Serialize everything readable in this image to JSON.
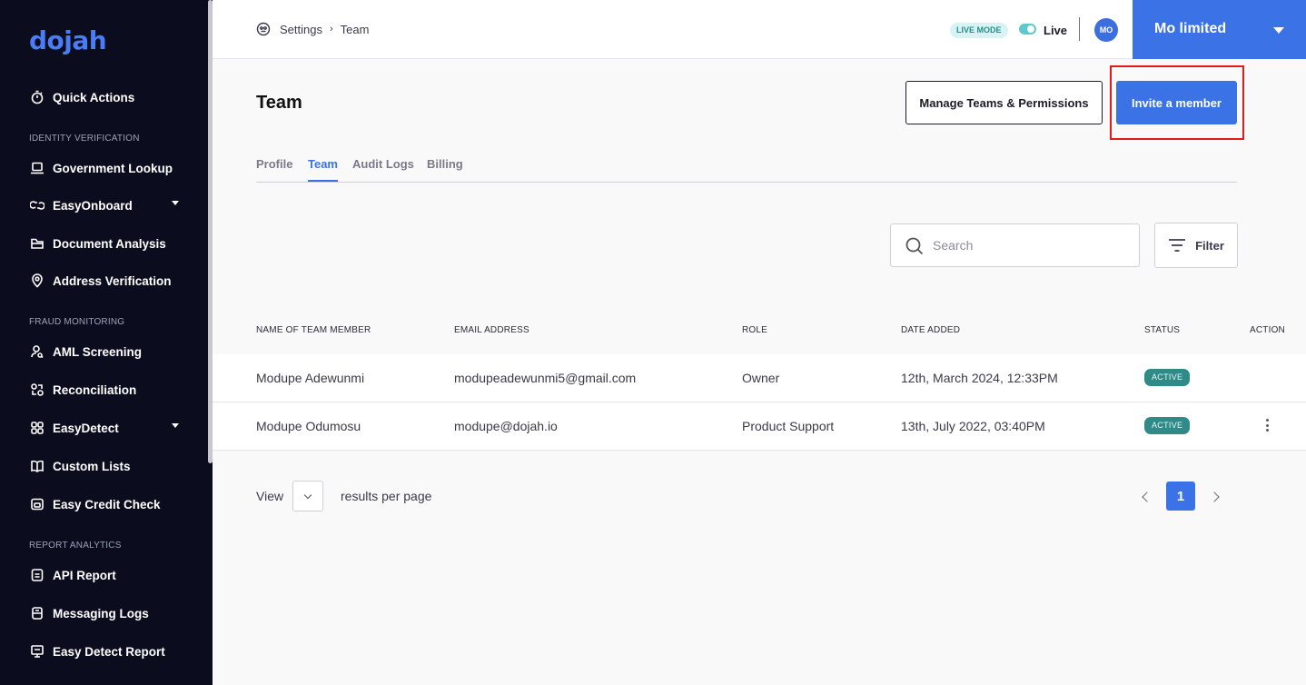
{
  "brand": {
    "logo_text": "dojah"
  },
  "sidebar": {
    "sections": {
      "identity": "IDENTITY VERIFICATION",
      "fraud": "FRAUD MONITORING",
      "report": "REPORT ANALYTICS"
    },
    "items": [
      {
        "label": "Quick Actions",
        "icon": "stopwatch-icon"
      },
      {
        "label": "Government Lookup",
        "icon": "laptop-icon"
      },
      {
        "label": "EasyOnboard",
        "icon": "link-icon",
        "has_caret": true
      },
      {
        "label": "Document Analysis",
        "icon": "folder-icon"
      },
      {
        "label": "Address Verification",
        "icon": "location-pin-icon"
      },
      {
        "label": "AML Screening",
        "icon": "user-search-icon"
      },
      {
        "label": "Reconciliation",
        "icon": "reconcile-icon"
      },
      {
        "label": "EasyDetect",
        "icon": "grid-icon",
        "has_caret": true
      },
      {
        "label": "Custom Lists",
        "icon": "book-icon"
      },
      {
        "label": "Easy Credit Check",
        "icon": "card-icon"
      },
      {
        "label": "API Report",
        "icon": "document-icon"
      },
      {
        "label": "Messaging Logs",
        "icon": "message-icon"
      },
      {
        "label": "Easy Detect Report",
        "icon": "monitor-icon"
      }
    ]
  },
  "topbar": {
    "breadcrumb": {
      "root": "Settings",
      "current": "Team"
    },
    "mode_badge": "LIVE MODE",
    "live_label": "Live",
    "avatar_initials": "MO",
    "org_name": "Mo limited"
  },
  "main": {
    "title": "Team",
    "manage_button": "Manage Teams & Permissions",
    "invite_button": "Invite a member",
    "tabs": [
      {
        "label": "Profile",
        "active": false
      },
      {
        "label": "Team",
        "active": true
      },
      {
        "label": "Audit Logs",
        "active": false
      },
      {
        "label": "Billing",
        "active": false
      }
    ],
    "search_placeholder": "Search",
    "filter_label": "Filter"
  },
  "table": {
    "headers": [
      "NAME OF TEAM MEMBER",
      "EMAIL ADDRESS",
      "ROLE",
      "DATE ADDED",
      "STATUS",
      "ACTION"
    ],
    "rows": [
      {
        "name": "Modupe Adewunmi",
        "email": "modupeadewunmi5@gmail.com",
        "role": "Owner",
        "date": "12th, March 2024, 12:33PM",
        "status": "ACTIVE",
        "has_action": false
      },
      {
        "name": "Modupe Odumosu",
        "email": "modupe@dojah.io",
        "role": "Product Support",
        "date": "13th, July 2022, 03:40PM",
        "status": "ACTIVE",
        "has_action": true
      }
    ]
  },
  "pagination": {
    "view_label": "View",
    "per_page_label": "results per page",
    "current_page": "1"
  },
  "colors": {
    "sidebar_bg": "#0b0d1f",
    "accent": "#3b73e7",
    "status_active": "#2e8b88",
    "highlight": "#e01b1b"
  }
}
